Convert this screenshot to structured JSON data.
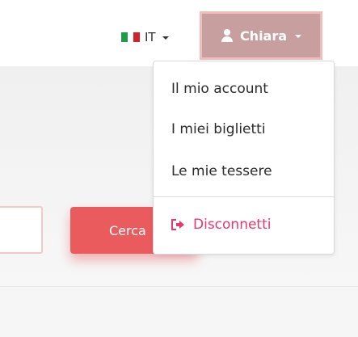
{
  "header": {
    "language": {
      "label": "IT",
      "flag_icon": "italy-flag-icon"
    },
    "user_menu": {
      "label": "Chiara",
      "icon": "user-icon"
    }
  },
  "dropdown": {
    "items": [
      {
        "label": "Il mio account"
      },
      {
        "label": "I miei biglietti"
      },
      {
        "label": "Le mie tessere"
      }
    ],
    "logout": {
      "label": "Disconnetti",
      "icon": "sign-out-icon"
    }
  },
  "search": {
    "button_label": "Cerca"
  },
  "colors": {
    "accent": "#ea5b5e",
    "logout": "#e8386b",
    "user_button": "#c89f9f"
  }
}
